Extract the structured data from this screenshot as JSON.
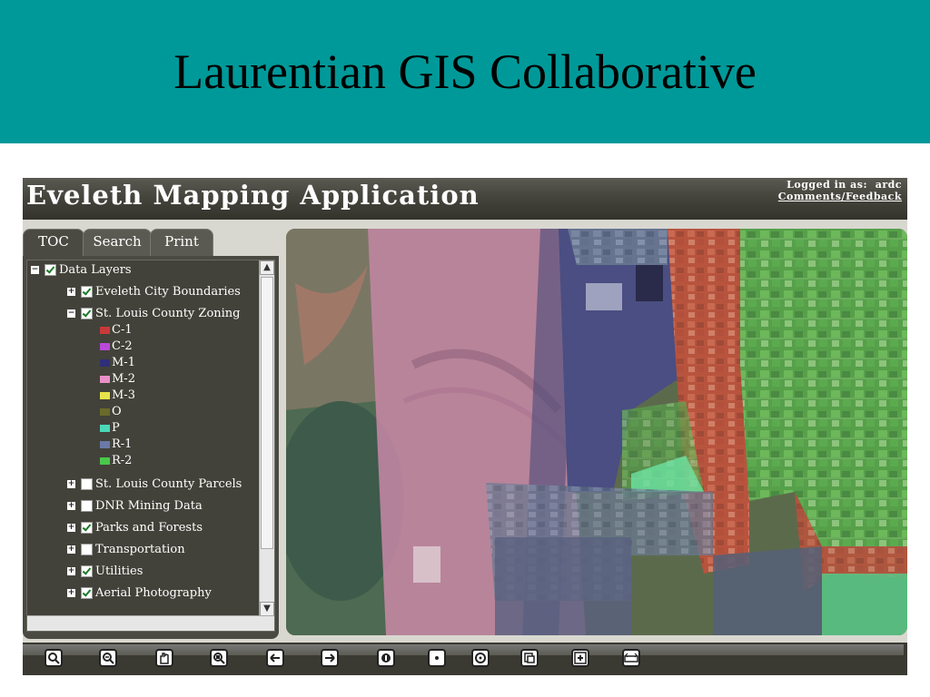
{
  "slide": {
    "title": "Laurentian GIS Collaborative"
  },
  "app": {
    "title": "Eveleth Mapping Application",
    "login_label": "Logged in as:",
    "login_user": "ardc",
    "feedback_link": "Comments/Feedback"
  },
  "tabs": [
    {
      "label": "TOC",
      "active": true
    },
    {
      "label": "Search",
      "active": false
    },
    {
      "label": "Print",
      "active": false
    }
  ],
  "toc": {
    "root": {
      "label": "Data Layers",
      "checked": true,
      "expanded": true
    },
    "layers": [
      {
        "label": "Eveleth City Boundaries",
        "checked": true,
        "expanded": false
      },
      {
        "label": "St. Louis County Zoning",
        "checked": true,
        "expanded": true,
        "legend": [
          {
            "label": "C-1",
            "color": "#c83a3a"
          },
          {
            "label": "C-2",
            "color": "#b84ad8"
          },
          {
            "label": "M-1",
            "color": "#2f2f7a"
          },
          {
            "label": "M-2",
            "color": "#e890c8"
          },
          {
            "label": "M-3",
            "color": "#e8e24a"
          },
          {
            "label": "O",
            "color": "#6a6a2a"
          },
          {
            "label": "P",
            "color": "#4ad8b8"
          },
          {
            "label": "R-1",
            "color": "#6a7aa8"
          },
          {
            "label": "R-2",
            "color": "#4ac84a"
          }
        ]
      },
      {
        "label": "St. Louis County Parcels",
        "checked": false,
        "expanded": false
      },
      {
        "label": "DNR Mining Data",
        "checked": false,
        "expanded": false
      },
      {
        "label": "Parks and Forests",
        "checked": true,
        "expanded": false
      },
      {
        "label": "Transportation",
        "checked": false,
        "expanded": false
      },
      {
        "label": "Utilities",
        "checked": true,
        "expanded": false
      },
      {
        "label": "Aerial Photography",
        "checked": true,
        "expanded": false
      }
    ]
  },
  "toolbar": {
    "tools": [
      "zoom-in-icon",
      "zoom-out-icon",
      "pan-hand-icon",
      "full-extent-icon",
      "previous-extent-icon",
      "next-extent-icon",
      "identify-icon",
      "select-point-icon",
      "select-circle-icon",
      "print-map-icon",
      "add-data-icon",
      "measure-icon"
    ]
  },
  "colors": {
    "title_bar": "#009999",
    "app_background": "#3a3a32"
  }
}
